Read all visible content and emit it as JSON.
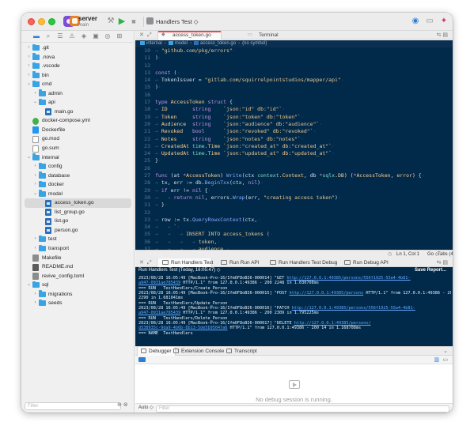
{
  "titlebar": {
    "scheme_name": "server",
    "scheme_branch": "main",
    "target": "Handlers Test ◇"
  },
  "sidebar": {
    "filter_placeholder": "Filter",
    "items": [
      {
        "label": ".git",
        "kind": "folder",
        "depth": 0,
        "expanded": false
      },
      {
        "label": ".nova",
        "kind": "folder",
        "depth": 0,
        "expanded": false
      },
      {
        "label": ".vscode",
        "kind": "folder",
        "depth": 0,
        "expanded": false
      },
      {
        "label": "bin",
        "kind": "folder",
        "depth": 0,
        "expanded": false
      },
      {
        "label": "cmd",
        "kind": "folder",
        "depth": 0,
        "expanded": true
      },
      {
        "label": "admin",
        "kind": "folder",
        "depth": 1,
        "expanded": false
      },
      {
        "label": "api",
        "kind": "folder",
        "depth": 1,
        "expanded": true
      },
      {
        "label": "main.go",
        "kind": "go",
        "depth": 2
      },
      {
        "label": "docker-compose.yml",
        "kind": "yml",
        "depth": 0
      },
      {
        "label": "Dockerfile",
        "kind": "docker",
        "depth": 0
      },
      {
        "label": "go.mod",
        "kind": "plain",
        "depth": 0
      },
      {
        "label": "go.sum",
        "kind": "plain",
        "depth": 0
      },
      {
        "label": "internal",
        "kind": "folder",
        "depth": 0,
        "expanded": true
      },
      {
        "label": "config",
        "kind": "folder",
        "depth": 1,
        "expanded": false
      },
      {
        "label": "database",
        "kind": "folder",
        "depth": 1,
        "expanded": false
      },
      {
        "label": "docker",
        "kind": "folder",
        "depth": 1,
        "expanded": false
      },
      {
        "label": "model",
        "kind": "folder",
        "depth": 1,
        "expanded": true
      },
      {
        "label": "access_token.go",
        "kind": "go",
        "depth": 2,
        "selected": true
      },
      {
        "label": "list_group.go",
        "kind": "go",
        "depth": 2
      },
      {
        "label": "list.go",
        "kind": "go",
        "depth": 2
      },
      {
        "label": "person.go",
        "kind": "go",
        "depth": 2
      },
      {
        "label": "test",
        "kind": "folder",
        "depth": 1,
        "expanded": false
      },
      {
        "label": "transport",
        "kind": "folder",
        "depth": 1,
        "expanded": false
      },
      {
        "label": "Makefile",
        "kind": "tool",
        "depth": 0
      },
      {
        "label": "README.md",
        "kind": "md",
        "depth": 0
      },
      {
        "label": "revive_config.toml",
        "kind": "toml",
        "depth": 0
      },
      {
        "label": "sql",
        "kind": "folder",
        "depth": 0,
        "expanded": true
      },
      {
        "label": "migrations",
        "kind": "folder",
        "depth": 1,
        "expanded": false
      },
      {
        "label": "seeds",
        "kind": "folder",
        "depth": 1,
        "expanded": false
      }
    ]
  },
  "editor": {
    "tabs": [
      "access_token.go",
      "Terminal"
    ],
    "breadcrumb": [
      "internal",
      "model",
      "access_token.go",
      "(no symbol)"
    ],
    "lines": [
      {
        "n": "10",
        "html": "<span class=\"g\">→ </span><span class=\"s\">\"github.com/pkg/errors\"</span><span class=\"g\">·</span>"
      },
      {
        "n": "11",
        "html": ")<span class=\"g\">·</span>"
      },
      {
        "n": "12",
        "html": ""
      },
      {
        "n": "13",
        "html": "<span class=\"k\">const</span> (<span class=\"g\">·</span>"
      },
      {
        "n": "14",
        "html": "<span class=\"g\">→ </span>TokenIssuer = <span class=\"s\">\"gitlab.com/squirrelpointstudios/mapper/api\"</span><span class=\"g\">·</span>"
      },
      {
        "n": "15",
        "html": ")<span class=\"g\">·</span>"
      },
      {
        "n": "16",
        "html": ""
      },
      {
        "n": "17",
        "html": "<span class=\"k\">type</span> <span class=\"t\">AccessToken</span> <span class=\"k\">struct</span> {<span class=\"g\">·</span>"
      },
      {
        "n": "18",
        "html": "<span class=\"g\">→ </span><span class=\"t\">ID</span>        <span class=\"k\">string</span>    <span class=\"s\">`json:\"id\" db:\"id\"`</span><span class=\"g\">·</span>"
      },
      {
        "n": "19",
        "html": "<span class=\"g\">→ </span><span class=\"t\">Token</span>     <span class=\"k\">string</span>    <span class=\"s\">`json:\"token\" db:\"token\"`</span><span class=\"g\">·</span>"
      },
      {
        "n": "20",
        "html": "<span class=\"g\">→ </span><span class=\"t\">Audience</span>  <span class=\"k\">string</span>    <span class=\"s\">`json:\"audience\" db:\"audience\"`</span><span class=\"g\">·</span>"
      },
      {
        "n": "21",
        "html": "<span class=\"g\">→ </span><span class=\"t\">Revoked</span>   <span class=\"k\">bool</span>      <span class=\"s\">`json:\"revoked\" db:\"revoked\"`</span><span class=\"g\">·</span>"
      },
      {
        "n": "22",
        "html": "<span class=\"g\">→ </span><span class=\"t\">Notes</span>     <span class=\"k\">string</span>    <span class=\"s\">`json:\"notes\" db:\"notes\"`</span><span class=\"g\">·</span>"
      },
      {
        "n": "23",
        "html": "<span class=\"g\">→ </span><span class=\"t\">CreatedAt</span> <span class=\"fd\">time</span>.<span class=\"t\">Time</span> <span class=\"s\">`json:\"created_at\" db:\"created_at\"`</span><span class=\"g\">·</span>"
      },
      {
        "n": "24",
        "html": "<span class=\"g\">→ </span><span class=\"t\">UpdatedAt</span> <span class=\"fd\">time</span>.<span class=\"t\">Time</span> <span class=\"s\">`json:\"updated_at\" db:\"updated_at\"`</span><span class=\"g\">·</span>"
      },
      {
        "n": "25",
        "html": "}<span class=\"g\">·</span>"
      },
      {
        "n": "26",
        "html": ""
      },
      {
        "n": "27",
        "html": "<span class=\"k\">func</span> (at <span class=\"k\">*</span><span class=\"t\">AccessToken</span>) <span class=\"f\">Write</span>(ctx <span class=\"fd\">context</span>.<span class=\"t\">Context</span>, db <span class=\"k\">*</span><span class=\"fd\">sqlx</span>.<span class=\"t\">DB</span>) (<span class=\"k\">*</span><span class=\"t\">AccessToken</span>, <span class=\"t\">error</span>) {<span class=\"g\">·</span>"
      },
      {
        "n": "28",
        "html": "<span class=\"g\">→ </span>tx, err := db.<span class=\"f\">BeginTxx</span>(ctx, <span class=\"k\">nil</span>)<span class=\"g\">·</span>"
      },
      {
        "n": "29",
        "html": "<span class=\"g\">→ </span><span class=\"k\">if</span> err != <span class=\"k\">nil</span> {<span class=\"g\">·</span>"
      },
      {
        "n": "30",
        "html": "<span class=\"g\">→   → </span><span class=\"k\">return</span> <span class=\"k\">nil</span>, errors.<span class=\"f\">Wrap</span>(err, <span class=\"s\">\"creating access token\"</span>)<span class=\"g\">·</span>"
      },
      {
        "n": "31",
        "html": "<span class=\"g\">→ </span>}<span class=\"g\">·</span>"
      },
      {
        "n": "32",
        "html": ""
      },
      {
        "n": "33",
        "html": "<span class=\"g\">→ </span>row := tx.<span class=\"f\">QueryRowxContext</span>(ctx,<span class=\"g\">·</span>"
      },
      {
        "n": "34",
        "html": "<span class=\"g\">→   → </span><span class=\"s\">`</span><span class=\"g\">·</span>"
      },
      {
        "n": "35",
        "html": "<span class=\"g\">→   →   → </span><span class=\"s\">INSERT INTO access_tokens (</span><span class=\"g\">·</span>"
      },
      {
        "n": "36",
        "html": "<span class=\"g\">→   →   →   → </span><span class=\"s\">token,</span><span class=\"g\">·</span>"
      },
      {
        "n": "37",
        "html": "<span class=\"g\">→   →   →   → </span><span class=\"s\">audience,</span><span class=\"g\">·</span>"
      }
    ]
  },
  "statusbar": {
    "position": "Ln 1, Col 1",
    "language": "Go ◇",
    "indent": "Tabs (4 sp) ◇"
  },
  "run_panel": {
    "tabs": [
      "Run Handlers Test",
      "Run Run API",
      "Run Handlers Test Debug",
      "Run Debug API"
    ],
    "session": "Run Handlers Test (Today, 16:05:47) ◇",
    "save_report": "Save Report...",
    "output": [
      [
        {
          "t": "2023/08/28 16:05:49 [MacBook-Pro-16/IfmOF8oBI6-000014] \"GET "
        },
        {
          "t": "http://127.0.0.1:49385/persons/556f1925-55a4-4b81-",
          "u": true
        }
      ],
      [
        {
          "t": "a947-0931ae785439",
          "u": true
        },
        {
          "t": " HTTP/1.1\" from 127.0.0.1:49386 - 200 2248 in 1.030708ms"
        }
      ],
      [
        {
          "t": "=== RUN   TestHandlers/Create_Person"
        }
      ],
      [
        {
          "t": "2023/08/28 16:05:49 [MacBook-Pro-16/IfmOF8oBI6-000015] \"POST "
        },
        {
          "t": "http://127.0.0.1:49385/persons",
          "u": true
        },
        {
          "t": " HTTP/1.1\" from 127.0.0.1:49386 - 200"
        }
      ],
      [
        {
          "t": "2290 in 1.681041ms"
        }
      ],
      [
        {
          "t": "=== RUN   TestHandlers/Update_Person"
        }
      ],
      [
        {
          "t": "2023/08/28 16:05:49 [MacBook-Pro-16/IfmOF8oBI6-000016] \"PATCH "
        },
        {
          "t": "http://127.0.0.1:49385/persons/556f1925-55a4-4b81-",
          "u": true
        }
      ],
      [
        {
          "t": "a947-0931ae785439",
          "u": true
        },
        {
          "t": " HTTP/1.1\" from 127.0.0.1:49386 - 200 2309 in 1.795225ms"
        }
      ],
      [
        {
          "t": "=== RUN   TestHandlers/Delete_Person"
        }
      ],
      [
        {
          "t": "2023/08/28 16:05:49 [MacBook-Pro-16/IfmOF8oBI6-000017] \"DELETE "
        },
        {
          "t": "http://127.0.0.1:49385/persons/",
          "u": true
        }
      ],
      [
        {
          "t": "d538935c-9da9-4b6b-8b13-5de5b95047a6",
          "u": true
        },
        {
          "t": " HTTP/1.1\" from 127.0.0.1:49386 - 200 14 in 1.168708ms"
        }
      ],
      [
        {
          "t": "=== NAME  TestHandlers"
        }
      ]
    ]
  },
  "debugger": {
    "tabs": [
      "Debugger",
      "Extension Console",
      "Transcript"
    ],
    "empty_message": "No debug session is running.",
    "auto_label": "Auto ◇",
    "filter_placeholder": "Filter"
  }
}
